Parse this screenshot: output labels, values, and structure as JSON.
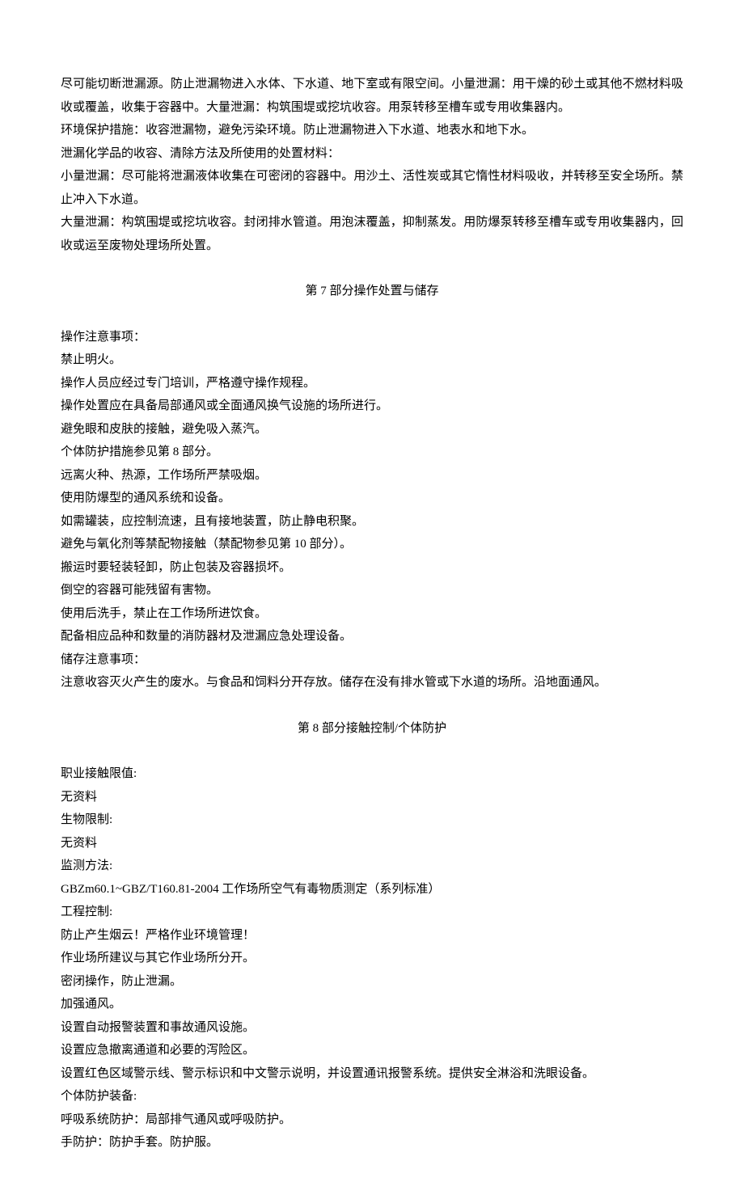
{
  "section6_tail": {
    "p1": "尽可能切断泄漏源。防止泄漏物进入水体、下水道、地下室或有限空间。小量泄漏：用干燥的砂土或其他不燃材料吸收或覆盖，收集于容器中。大量泄漏：构筑围堤或挖坑收容。用泵转移至槽车或专用收集器内。",
    "p2": "环境保护措施：收容泄漏物，避免污染环境。防止泄漏物进入下水道、地表水和地下水。",
    "p3": "泄漏化学品的收容、清除方法及所使用的处置材料：",
    "p4": "小量泄漏：尽可能将泄漏液体收集在可密闭的容器中。用沙土、活性炭或其它惰性材料吸收，并转移至安全场所。禁止冲入下水道。",
    "p5": "大量泄漏：构筑围堤或挖坑收容。封闭排水管道。用泡沫覆盖，抑制蒸发。用防爆泵转移至槽车或专用收集器内，回收或运至废物处理场所处置。"
  },
  "section7": {
    "title": "第 7 部分操作处置与储存",
    "lines": [
      "操作注意事项：",
      "禁止明火。",
      "操作人员应经过专门培训，严格遵守操作规程。",
      "操作处置应在具备局部通风或全面通风换气设施的场所进行。",
      "避免眼和皮肤的接触，避免吸入蒸汽。",
      "个体防护措施参见第 8 部分。",
      "远离火种、热源，工作场所严禁吸烟。",
      "使用防爆型的通风系统和设备。",
      "如需罐装，应控制流速，且有接地装置，防止静电积聚。",
      "避免与氧化剂等禁配物接触（禁配物参见第 10 部分）。",
      "搬运时要轻装轻卸，防止包装及容器损坏。",
      "倒空的容器可能残留有害物。",
      "使用后洗手，禁止在工作场所进饮食。",
      "配备相应品种和数量的消防器材及泄漏应急处理设备。",
      "储存注意事项：",
      "注意收容灭火产生的废水。与食品和饲料分开存放。储存在没有排水管或下水道的场所。沿地面通风。"
    ]
  },
  "section8": {
    "title": "第 8 部分接触控制/个体防护",
    "lines": [
      "职业接触限值:",
      "无资料",
      "生物限制:",
      "无资料",
      "监测方法:",
      "GBZm60.1~GBZ/T160.81-2004 工作场所空气有毒物质测定（系列标准）",
      "工程控制:",
      "防止产生烟云！严格作业环境管理！",
      "作业场所建议与其它作业场所分开。",
      "密闭操作，防止泄漏。",
      "加强通风。",
      "设置自动报警装置和事故通风设施。",
      "设置应急撤离通道和必要的泻险区。",
      "设置红色区域警示线、警示标识和中文警示说明，并设置通讯报警系统。提供安全淋浴和洗眼设备。",
      "个体防护装备:",
      "呼吸系统防护：局部排气通风或呼吸防护。",
      "手防护：防护手套。防护服。"
    ]
  }
}
